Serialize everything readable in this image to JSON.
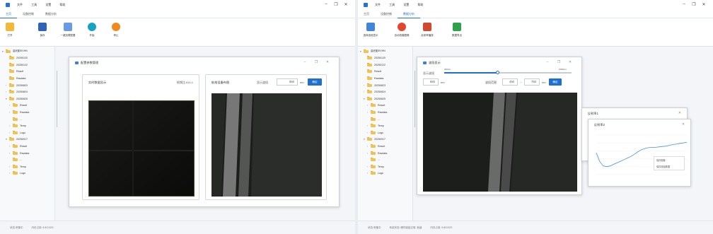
{
  "left": {
    "menu": [
      "文件",
      "工具",
      "设置",
      "帮助"
    ],
    "tabs": [
      "主页",
      "设备控制",
      "数据分析"
    ],
    "ribbon": [
      "打开",
      "保存",
      "一键加载配置",
      "开始",
      "停止"
    ],
    "tree": [
      {
        "label": "曲光影EVHN",
        "depth": 0,
        "caret": "▾"
      },
      {
        "label": "20250120",
        "depth": 1,
        "caret": ""
      },
      {
        "label": "20250122",
        "depth": 1,
        "caret": ""
      },
      {
        "label": "Result",
        "depth": 1,
        "caret": ""
      },
      {
        "label": "Ravdata",
        "depth": 1,
        "caret": ""
      },
      {
        "label": "20250823",
        "depth": 1,
        "caret": "›"
      },
      {
        "label": "20250824",
        "depth": 1,
        "caret": "›"
      },
      {
        "label": "20250825",
        "depth": 1,
        "caret": "▾"
      },
      {
        "label": "Result",
        "depth": 2,
        "caret": "›"
      },
      {
        "label": "Ravdata",
        "depth": 2,
        "caret": "›"
      },
      {
        "label": "...",
        "depth": 2,
        "caret": ""
      },
      {
        "label": "Temp",
        "depth": 2,
        "caret": "›"
      },
      {
        "label": "Logo",
        "depth": 2,
        "caret": "›"
      },
      {
        "label": "20250917",
        "depth": 1,
        "caret": "▾"
      },
      {
        "label": "Result",
        "depth": 2,
        "caret": "›"
      },
      {
        "label": "Ravdata",
        "depth": 2,
        "caret": "›"
      },
      {
        "label": "...",
        "depth": 2,
        "caret": ""
      },
      {
        "label": "Temp",
        "depth": 2,
        "caret": "›"
      },
      {
        "label": "Logo",
        "depth": 2,
        "caret": "›"
      }
    ],
    "status": [
      "状态:采集中",
      "内存占用: 5.8G/32G"
    ],
    "dialog": {
      "title": "配置参数管理",
      "panel1_title": "实时数据显示",
      "frame_rate": "帧频比  614.1",
      "panel2_title": "航拍设备布图",
      "wavelength_label": "显示波段",
      "wavelength_value": "650",
      "unit": "nm",
      "confirm": "确定"
    }
  },
  "right": {
    "menu": [
      "文件",
      "工具",
      "设置",
      "帮助"
    ],
    "tabs": [
      "主页",
      "设备控制",
      "数据分析"
    ],
    "ribbon": [
      "选择波段显示",
      "自动拍摄图像",
      "反射率播放",
      "数据导出"
    ],
    "tree": [
      {
        "label": "曲光影EVHN",
        "depth": 0,
        "caret": "▾"
      },
      {
        "label": "20250120",
        "depth": 1,
        "caret": ""
      },
      {
        "label": "20250122",
        "depth": 1,
        "caret": ""
      },
      {
        "label": "Result",
        "depth": 1,
        "caret": ""
      },
      {
        "label": "Ravdata",
        "depth": 1,
        "caret": ""
      },
      {
        "label": "20250823",
        "depth": 1,
        "caret": "›"
      },
      {
        "label": "20250824",
        "depth": 1,
        "caret": "›"
      },
      {
        "label": "20250825",
        "depth": 1,
        "caret": "▾"
      },
      {
        "label": "Result",
        "depth": 2,
        "caret": "›"
      },
      {
        "label": "Ravdata",
        "depth": 2,
        "caret": "›"
      },
      {
        "label": "...",
        "depth": 2,
        "caret": ""
      },
      {
        "label": "Temp",
        "depth": 2,
        "caret": "›"
      },
      {
        "label": "Logo",
        "depth": 2,
        "caret": "›"
      },
      {
        "label": "20250917",
        "depth": 1,
        "caret": "▾"
      },
      {
        "label": "Result",
        "depth": 2,
        "caret": "›"
      },
      {
        "label": "Ravdata",
        "depth": 2,
        "caret": "›"
      },
      {
        "label": "...",
        "depth": 2,
        "caret": ""
      },
      {
        "label": "Temp",
        "depth": 2,
        "caret": "›"
      },
      {
        "label": "Logo",
        "depth": 2,
        "caret": "›"
      }
    ],
    "status": [
      "状态:采集中",
      "系统状态: 硬件链接正常, 就绪",
      "内存占用: 5.8G/32G"
    ],
    "dialog": {
      "title": "波段显示",
      "band_label": "显示波段",
      "slider_min": "400nm",
      "slider_max": "1000nm",
      "slider_fraction": 0.42,
      "band_value": "650",
      "unit": "nm",
      "range_label": "波段范围",
      "range_from": "450",
      "range_sep": "~",
      "range_to": "750",
      "confirm": "确定"
    },
    "refl1": {
      "title": "反射率1"
    },
    "refl2": {
      "title": "反射率2",
      "menu": [
        "保存图像",
        "保存原始数据"
      ]
    }
  },
  "chart_data": {
    "type": "line",
    "series": [
      {
        "values": [
          0.55,
          0.33,
          0.22,
          0.2,
          0.22,
          0.26,
          0.3,
          0.34,
          0.38,
          0.42,
          0.46,
          0.52,
          0.58,
          0.63,
          0.66,
          0.68,
          0.69,
          0.69,
          0.7,
          0.71,
          0.72,
          0.74,
          0.76,
          0.77,
          0.79,
          0.8,
          0.82
        ]
      }
    ],
    "grid": true
  }
}
